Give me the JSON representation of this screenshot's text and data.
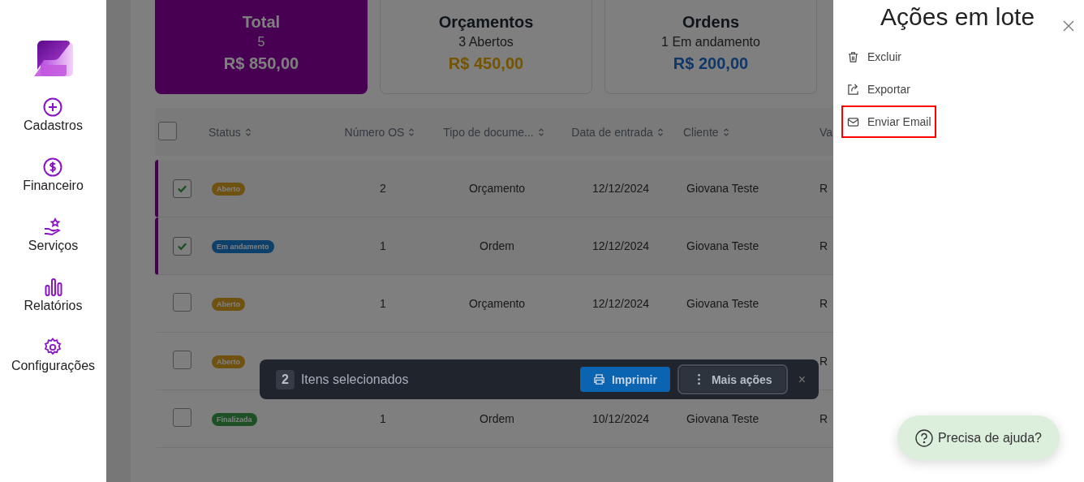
{
  "sidebar": {
    "items": [
      {
        "label": "Cadastros"
      },
      {
        "label": "Financeiro"
      },
      {
        "label": "Serviços"
      },
      {
        "label": "Relatórios"
      },
      {
        "label": "Configurações"
      }
    ]
  },
  "summary_cards": [
    {
      "kind": "total",
      "title": "Total",
      "subtitle": "5",
      "amount": "R$ 850,00"
    },
    {
      "kind": "quotes",
      "title": "Orçamentos",
      "subtitle": "3 Abertos",
      "amount": "R$ 450,00"
    },
    {
      "kind": "orders",
      "title": "Ordens",
      "subtitle": "1 Em andamento",
      "amount": "R$ 200,00"
    }
  ],
  "table": {
    "all_checked": false,
    "columns": [
      {
        "label": "Status",
        "sortable": true
      },
      {
        "label": "Número OS",
        "sortable": true
      },
      {
        "label": "Tipo de docume...",
        "sortable": true
      },
      {
        "label": "Data de entrada",
        "sortable": true
      },
      {
        "label": "Cliente",
        "sortable": true
      },
      {
        "label": "Va",
        "sortable": false
      }
    ],
    "rows": [
      {
        "selected": true,
        "checked": true,
        "status": {
          "label": "Aberto",
          "kind": "open"
        },
        "number": "2",
        "doc_type": "Orçamento",
        "date": "12/12/2024",
        "client": "Giovana Teste",
        "column_6": "R"
      },
      {
        "selected": true,
        "checked": true,
        "status": {
          "label": "Em andamento",
          "kind": "in_progress"
        },
        "number": "1",
        "doc_type": "Ordem",
        "date": "12/12/2024",
        "client": "Giovana Teste",
        "column_6": "R"
      },
      {
        "selected": false,
        "checked": false,
        "status": {
          "label": "Aberto",
          "kind": "open"
        },
        "number": "1",
        "doc_type": "Orçamento",
        "date": "12/12/2024",
        "client": "Giovana Teste",
        "column_6": "R"
      },
      {
        "selected": false,
        "checked": false,
        "status": {
          "label": "Aberto",
          "kind": "open"
        },
        "column_6": "R"
      },
      {
        "selected": false,
        "checked": false,
        "status": {
          "label": "Finalizada",
          "kind": "done"
        },
        "number": "1",
        "doc_type": "Ordem",
        "date": "10/12/2024",
        "client": "Giovana Teste",
        "column_6": "R"
      }
    ]
  },
  "selection_bar": {
    "count": "2",
    "label": "Itens selecionados",
    "buttons": [
      {
        "kind": "primary",
        "label": "Imprimir"
      },
      {
        "kind": "secondary",
        "label": "Mais ações"
      }
    ],
    "close": "×"
  },
  "batch_panel": {
    "title": "Ações em lote",
    "actions": [
      {
        "label": "Excluir",
        "highlighted": false
      },
      {
        "label": "Exportar",
        "highlighted": false
      },
      {
        "label": "Enviar Email",
        "highlighted": true
      }
    ]
  },
  "help_button": {
    "label": "Precisa de ajuda?"
  }
}
